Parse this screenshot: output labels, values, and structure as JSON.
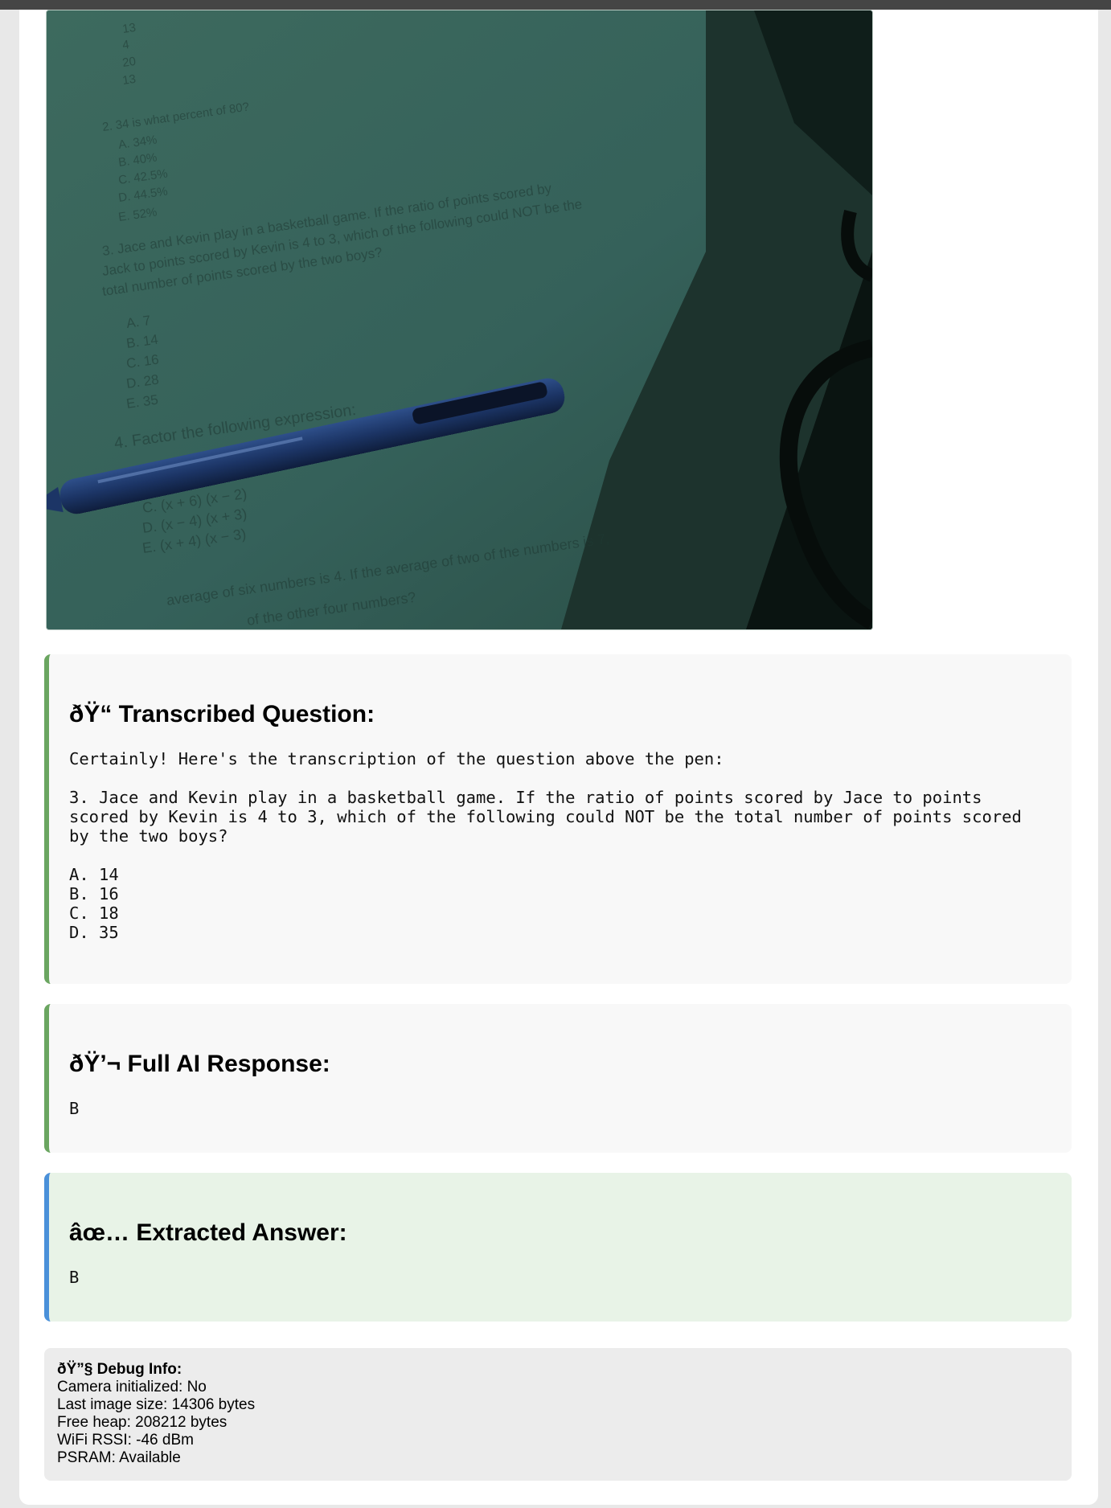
{
  "camera": {
    "alt": "captured camera image of worksheet with pen",
    "paper_lines": [
      "13",
      "4",
      "20",
      "13",
      "2.  34 is what percent of 80?",
      "A.  34%",
      "B.  40%",
      "C.  42.5%",
      "D.  44.5%",
      "E.  52%",
      "3.  Jace and Kevin play in a basketball game.  If the ratio of points scored by",
      "Jack to points scored by Kevin is 4 to 3, which of the following could NOT be the",
      "total number of points scored by the two boys?",
      "A.  7",
      "B.  14",
      "C.  16",
      "D.  28",
      "E.  35",
      "4.  Factor the following expression:",
      "C.  (x + 6) (x − 2)",
      "D.  (x − 4) (x + 3)",
      "E.  (x + 4) (x − 3)",
      "average of six numbers is 4.  If the average of two of the numbers is 7,",
      "of the other four numbers?"
    ]
  },
  "transcribed": {
    "title": "ðŸ“     Transcribed Question:",
    "body": "Certainly! Here's the transcription of the question above the pen:\n\n3. Jace and Kevin play in a basketball game. If the ratio of points scored by Jace to points\nscored by Kevin is 4 to 3, which of the following could NOT be the total number of points scored\nby the two boys?\n\nA. 14\nB. 16\nC. 18\nD. 35"
  },
  "full_response": {
    "title": "ðŸ’¬ Full AI Response:",
    "body": "B"
  },
  "extracted": {
    "title": "âœ… Extracted Answer:",
    "body": "B"
  },
  "debug": {
    "title": "ðŸ”§ Debug Info:",
    "lines": [
      "Camera initialized: No",
      "Last image size: 14306 bytes",
      "Free heap: 208212 bytes",
      "WiFi RSSI: -46 dBm",
      "PSRAM: Available"
    ]
  },
  "colors": {
    "section_border": "#6aa560",
    "answer_border": "#4a90d9",
    "answer_bg": "#e8f3e7",
    "topbar": "#454545"
  }
}
